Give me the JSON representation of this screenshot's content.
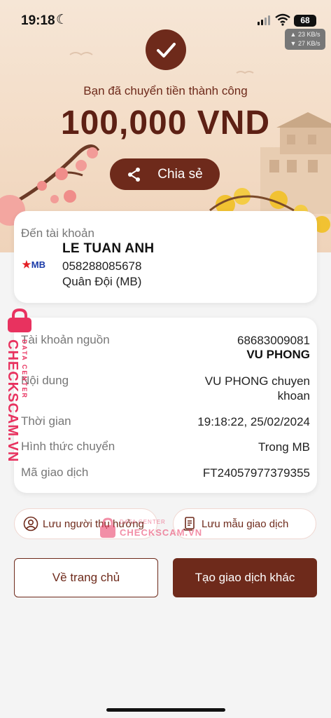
{
  "status_bar": {
    "time": "19:18",
    "battery": "68",
    "upload_speed": "▲ 23 KB/s",
    "download_speed": "▼ 27 KB/s"
  },
  "result": {
    "message": "Bạn đã chuyển tiền thành công",
    "amount": "100,000 VND",
    "share_label": "Chia sẻ"
  },
  "recipient": {
    "label": "Đến tài khoản",
    "bank_logo_text": "MB",
    "name": "LE TUAN ANH",
    "account": "058288085678",
    "bank": "Quân Đội (MB)"
  },
  "details": {
    "source_label": "Tài khoản nguồn",
    "source_account": "68683009081",
    "source_name": "VU PHONG",
    "content_label": "Nội dung",
    "content_value_line1": "VU PHONG chuyen",
    "content_value_line2": "khoan",
    "time_label": "Thời gian",
    "time_value": "19:18:22, 25/02/2024",
    "method_label": "Hình thức chuyển",
    "method_value": "Trong MB",
    "txn_label": "Mã giao dịch",
    "txn_value": "FT24057977379355"
  },
  "actions": {
    "save_recipient": "Lưu người thụ hưởng",
    "save_template": "Lưu mẫu giao dịch",
    "home": "Về trang chủ",
    "new_transaction": "Tạo giao dịch khác"
  },
  "watermark": {
    "brand": "CHECKSCAM.VN",
    "tagline": "DATA CENTER",
    "color": "#e8325f"
  },
  "theme": {
    "primary": "#6e2a1b",
    "hero_bg": "#f3dcc6"
  }
}
